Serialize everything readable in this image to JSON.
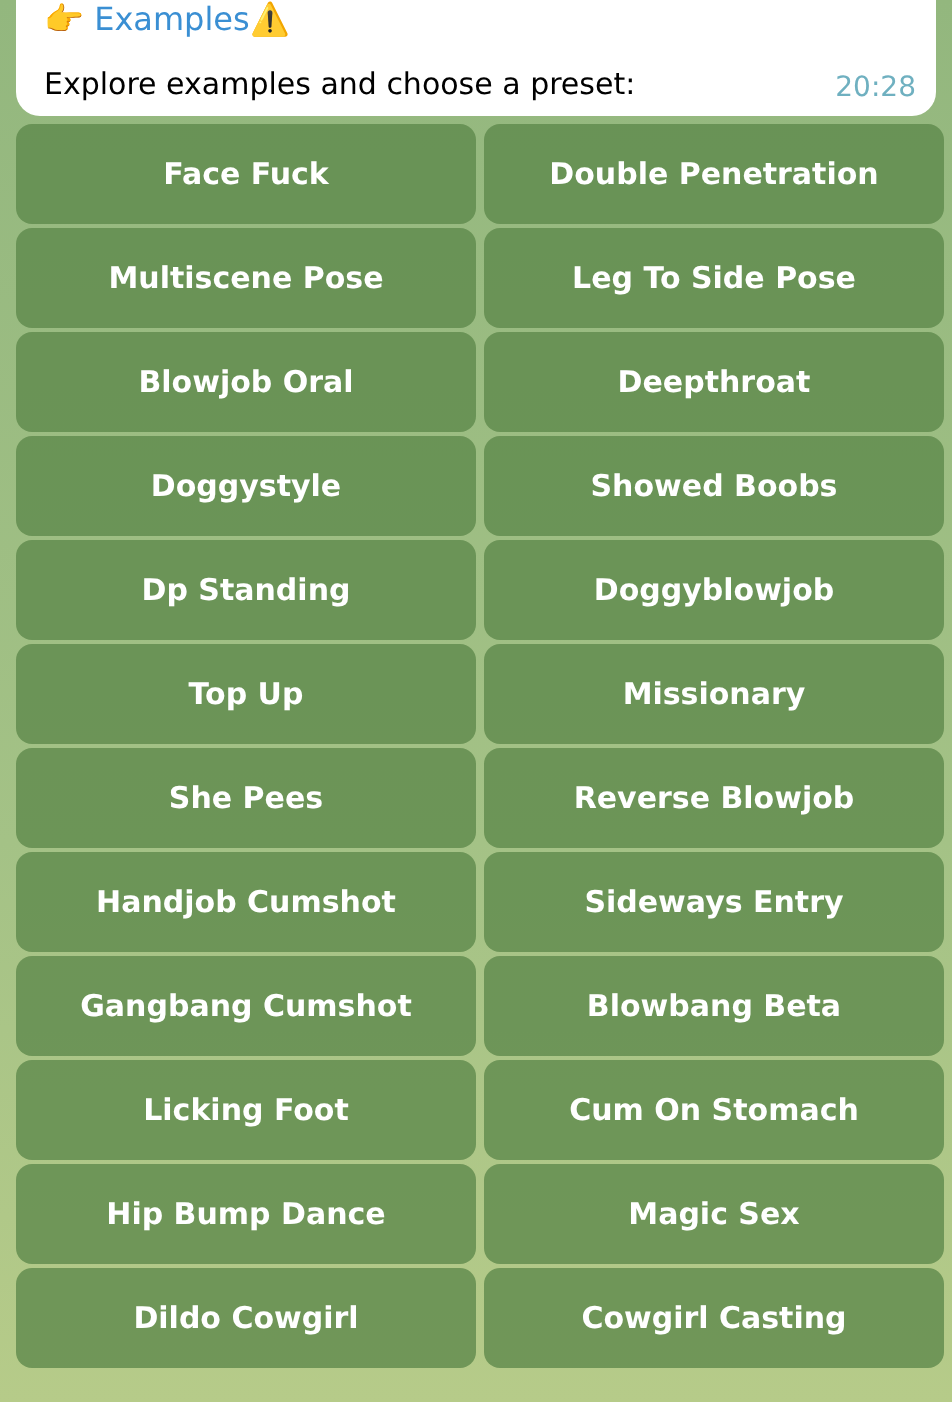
{
  "message": {
    "title": "👉 Examples⚠️",
    "text": "Explore examples and choose a preset:",
    "time": "20:28"
  },
  "keyboard": [
    [
      "Face Fuck",
      "Double Penetration"
    ],
    [
      "Multiscene Pose",
      "Leg To Side Pose"
    ],
    [
      "Blowjob Oral",
      "Deepthroat"
    ],
    [
      "Doggystyle",
      "Showed Boobs"
    ],
    [
      "Dp Standing",
      "Doggyblowjob"
    ],
    [
      "Top Up",
      "Missionary"
    ],
    [
      "She Pees",
      "Reverse Blowjob"
    ],
    [
      "Handjob Cumshot",
      "Sideways Entry"
    ],
    [
      "Gangbang Cumshot",
      "Blowbang Beta"
    ],
    [
      "Licking Foot",
      "Cum On Stomach"
    ],
    [
      "Hip Bump Dance",
      "Magic Sex"
    ],
    [
      "Dildo Cowgirl",
      "Cowgirl Casting"
    ]
  ]
}
